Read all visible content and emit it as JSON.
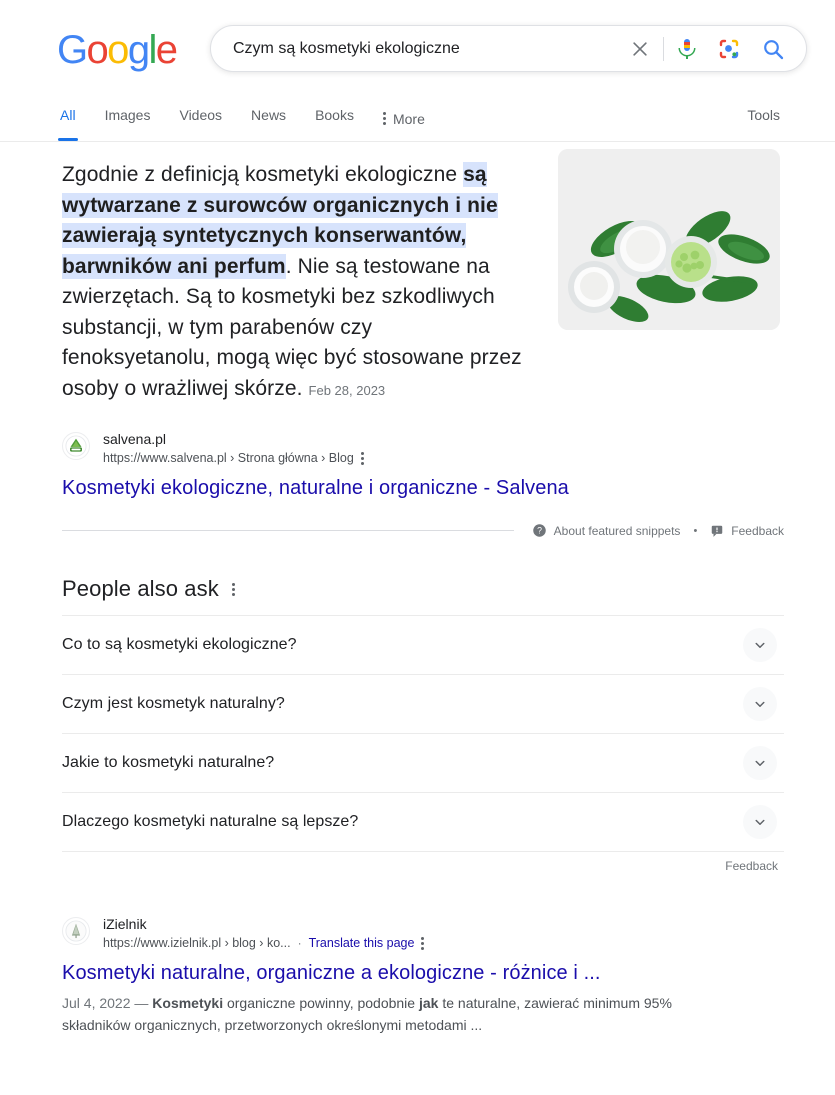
{
  "brand": {
    "logo_text": "Google",
    "logo_letters": [
      "G",
      "o",
      "o",
      "g",
      "l",
      "e"
    ]
  },
  "search": {
    "query": "Czym są kosmetyki ekologiczne",
    "placeholder": "Search",
    "clear_icon": "close-icon",
    "voice_icon": "microphone-icon",
    "lens_icon": "google-lens-icon",
    "search_icon": "search-icon"
  },
  "nav": {
    "tabs": [
      {
        "label": "All",
        "active": true
      },
      {
        "label": "Images",
        "active": false
      },
      {
        "label": "Videos",
        "active": false
      },
      {
        "label": "News",
        "active": false
      },
      {
        "label": "Books",
        "active": false
      }
    ],
    "more_label": "More",
    "more_icon": "more-vertical-icon",
    "tools_label": "Tools"
  },
  "featured_snippet": {
    "text_plain": "Zgodnie z definicją kosmetyki ekologiczne są wytwarzane z surowców organicznych i nie zawierają syntetycznych konserwantów, barwników ani perfum. Nie są testowane na zwierzętach. Są to kosmetyki bez szkodliwych substancji, w tym parabenów czy fenoksyetanolu, mogą więc być stosowane przez osoby o wrażliwej skórze.",
    "lead_text": "Zgodnie z definicją kosmetyki ekologiczne ",
    "highlighted_text": "są wytwarzane z surowców organicznych i nie zawierają syntetycznych konserwantów, barwników ani perfum",
    "trail_text": ". Nie są testowane na zwierzętach. Są to kosmetyki bez szkodliwych substancji, w tym parabenów czy fenoksyetanolu, mogą więc być stosowane przez osoby o wrażliwej skórze. ",
    "date": "Feb 28, 2023",
    "image_alt": "cosmetic-jars-with-green-leaves-thumbnail",
    "source": {
      "site_name": "salvena.pl",
      "url": "https://www.salvena.pl › Strona główna › Blog",
      "favicon": "salvena-leaf-favicon",
      "title": "Kosmetyki ekologiczne, naturalne i organiczne - Salvena",
      "menu_icon": "more-vertical-icon"
    },
    "footer": {
      "about_icon": "help-circle-icon",
      "about_label": "About featured snippets",
      "separator": "•",
      "feedback_icon": "feedback-flag-icon",
      "feedback_label": "Feedback"
    }
  },
  "people_also_ask": {
    "title": "People also ask",
    "menu_icon": "more-vertical-icon",
    "questions": [
      {
        "text": "Co to są kosmetyki ekologiczne?",
        "expand_icon": "chevron-down-icon"
      },
      {
        "text": "Czym jest kosmetyk naturalny?",
        "expand_icon": "chevron-down-icon"
      },
      {
        "text": "Jakie to kosmetyki naturalne?",
        "expand_icon": "chevron-down-icon"
      },
      {
        "text": "Dlaczego kosmetyki naturalne są lepsze?",
        "expand_icon": "chevron-down-icon"
      }
    ],
    "feedback_label": "Feedback"
  },
  "results": [
    {
      "site_name": "iZielnik",
      "favicon": "izielnik-tree-favicon",
      "url": "https://www.izielnik.pl › blog › ko...",
      "separator": "·",
      "translate_label": "Translate this page",
      "menu_icon": "more-vertical-icon",
      "title": "Kosmetyki naturalne, organiczne a ekologiczne - różnice i ...",
      "date": "Jul 4, 2022",
      "dash": "—",
      "desc_part1": " ",
      "desc_bold1": "Kosmetyki",
      "desc_part2": " organiczne powinny, podobnie ",
      "desc_bold2": "jak",
      "desc_part3": " te naturalne, zawierać minimum 95% składników organicznych, przetworzonych określonymi metodami ..."
    }
  ],
  "colors": {
    "link_blue": "#1a0dab",
    "accent_blue": "#1a73e8",
    "highlight": "#d7e3fc",
    "text_gray": "#70757a",
    "google_blue": "#4285F4",
    "google_red": "#EA4335",
    "google_yellow": "#FBBC05",
    "google_green": "#34A853"
  }
}
